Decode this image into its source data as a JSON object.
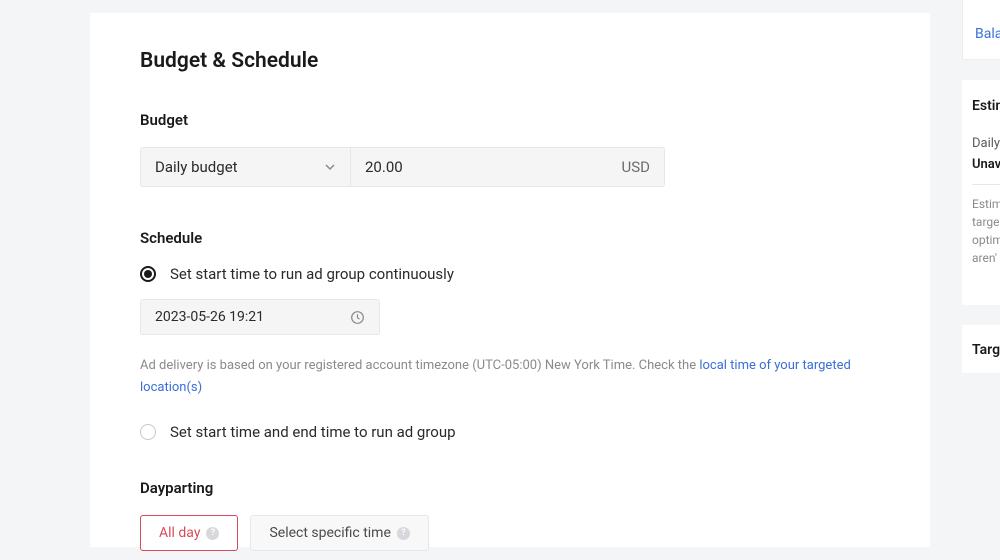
{
  "section": {
    "title": "Budget & Schedule"
  },
  "budget": {
    "label": "Budget",
    "type_selected": "Daily budget",
    "amount": "20.00",
    "currency": "USD"
  },
  "schedule": {
    "label": "Schedule",
    "option_continuous": "Set start time to run ad group continuously",
    "start_datetime": "2023-05-26 19:21",
    "note_prefix": "Ad delivery is based on your registered account timezone ",
    "note_tz": "(UTC-05:00) New York Time.",
    "note_check": " Check the ",
    "note_link": "local time of your targeted location(s)",
    "option_range": "Set start time and end time to run ad group"
  },
  "dayparting": {
    "label": "Dayparting",
    "all_day": "All day",
    "specific": "Select specific time"
  },
  "side": {
    "balance": "Bala",
    "estimate_hd": "Estin",
    "daily": "Daily",
    "unav": "Unav",
    "l1": "Estim",
    "l2": "targe",
    "l3": "optim",
    "l4": "aren'",
    "targ": "Targ"
  }
}
